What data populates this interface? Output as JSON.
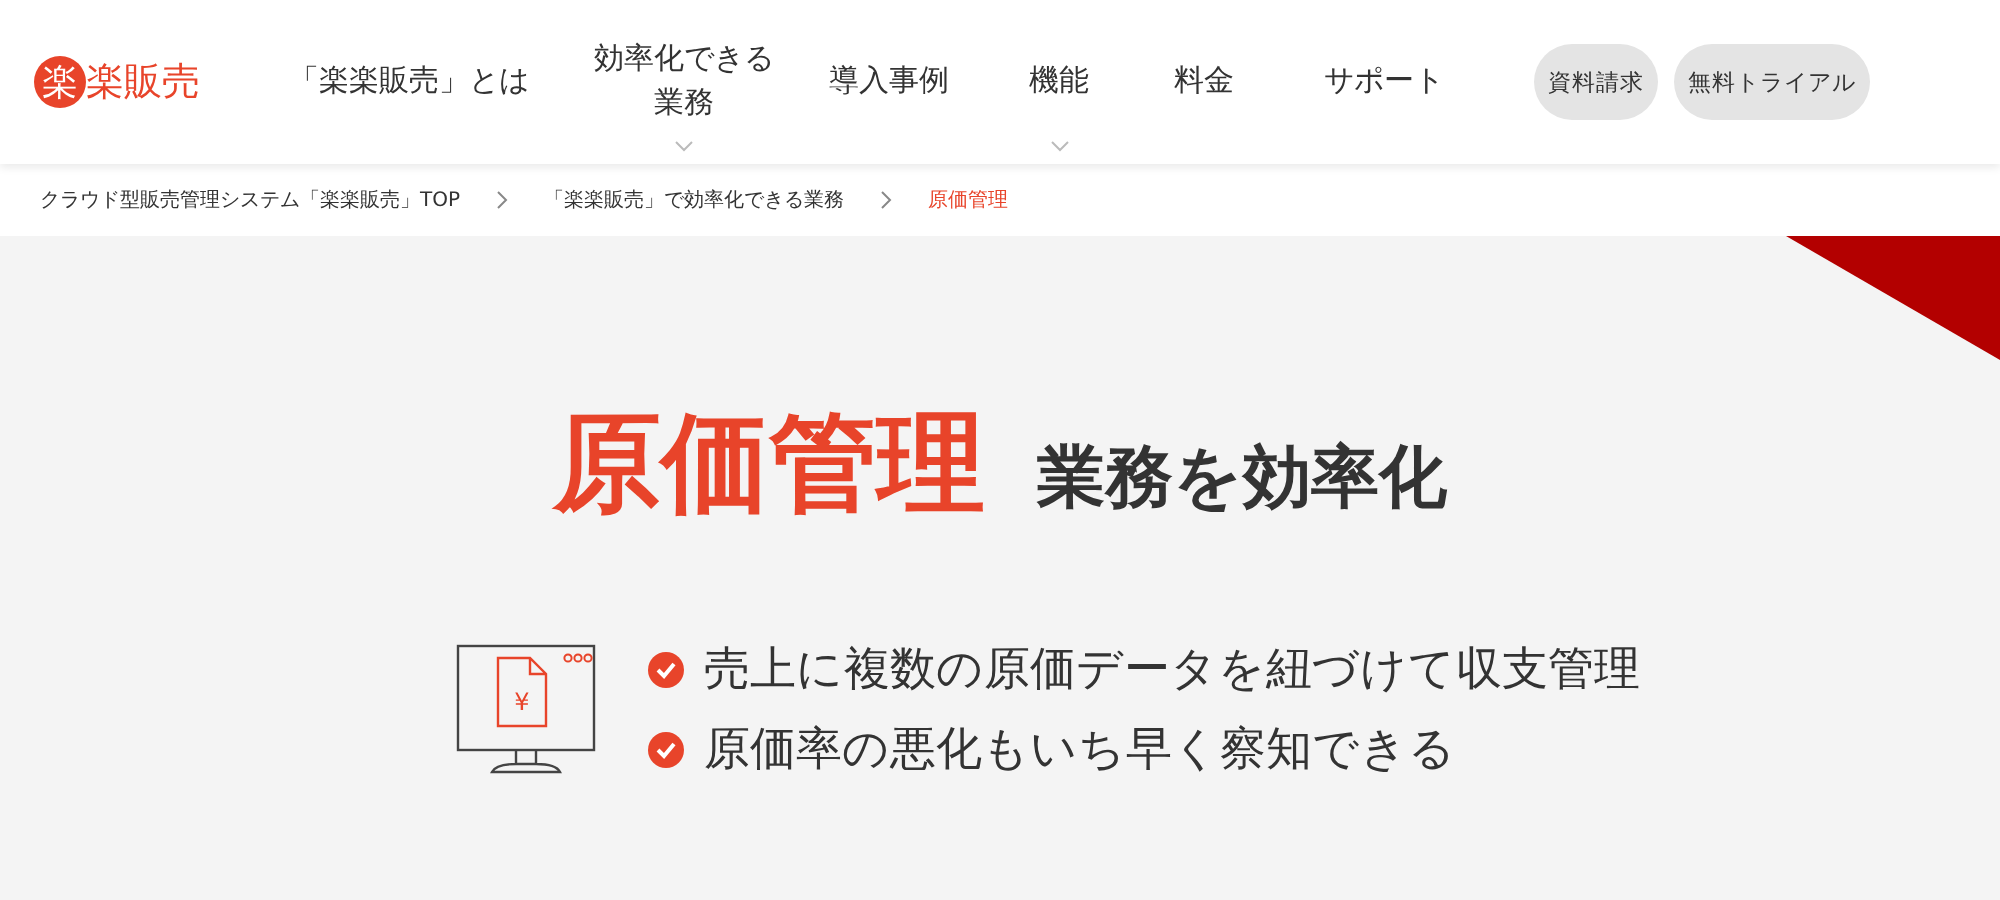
{
  "logo": {
    "mark": "楽",
    "text": "楽販売"
  },
  "nav": [
    {
      "label": "「楽楽販売」とは",
      "has_submenu": false
    },
    {
      "label": "効率化できる業務",
      "has_submenu": true
    },
    {
      "label": "導入事例",
      "has_submenu": false
    },
    {
      "label": "機能",
      "has_submenu": true
    },
    {
      "label": "料金",
      "has_submenu": false
    },
    {
      "label": "サポート",
      "has_submenu": false
    }
  ],
  "header_buttons": [
    "資料請求",
    "無料トライアル"
  ],
  "breadcrumb": [
    {
      "label": "クラウド型販売管理システム「楽楽販売」TOP",
      "current": false
    },
    {
      "label": "「楽楽販売」で効率化できる業務",
      "current": false
    },
    {
      "label": "原価管理",
      "current": true
    }
  ],
  "hero": {
    "title": "原価管理",
    "subtitle": "業務を効率化",
    "icon_glyph": "¥",
    "points": [
      "売上に複数の原価データを紐づけて収支管理",
      "原価率の悪化もいち早く察知できる"
    ]
  }
}
